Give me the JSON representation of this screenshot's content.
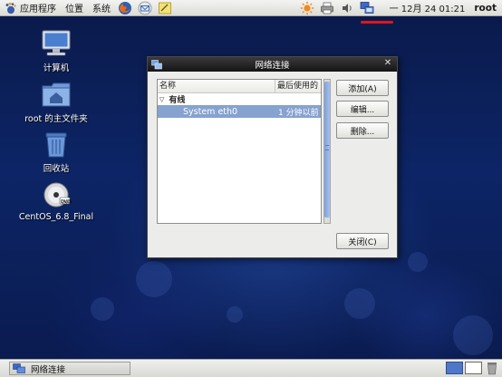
{
  "top_panel": {
    "menus": [
      {
        "label": "应用程序",
        "icon": "foot-icon"
      },
      {
        "label": "位置",
        "icon": ""
      },
      {
        "label": "系统",
        "icon": ""
      }
    ],
    "launchers": [
      "firefox-icon",
      "mail-icon",
      "notes-icon"
    ],
    "tray_icons": [
      "update-sun-icon",
      "printer-icon",
      "volume-icon",
      "network-icon"
    ],
    "clock": "一 12月 24 01:21",
    "user": "root"
  },
  "desktop": {
    "icons": [
      {
        "label": "计算机",
        "icon": "computer-icon"
      },
      {
        "label": "root 的主文件夹",
        "icon": "home-folder-icon"
      },
      {
        "label": "回收站",
        "icon": "trash-icon"
      },
      {
        "label": "CentOS_6.8_Final",
        "icon": "dvd-icon"
      }
    ]
  },
  "dialog": {
    "title": "网络连接",
    "columns": [
      "名称",
      "最后使用的"
    ],
    "groups": [
      {
        "label": "有线",
        "connections": [
          {
            "name": "System eth0",
            "last_used": "1 分钟以前",
            "selected": true
          }
        ]
      }
    ],
    "buttons": {
      "add": "添加(A)",
      "edit": "编辑...",
      "delete": "删除...",
      "close": "关闭(C)"
    }
  },
  "bottom_panel": {
    "task_label": "网络连接",
    "workspaces": 2,
    "active_workspace": 1
  },
  "colors": {
    "selection": "#86a2cf",
    "desktop_bg": "#0d2566",
    "titlebar": "#1e1e1e",
    "highlight_underline": "#e0151b"
  }
}
